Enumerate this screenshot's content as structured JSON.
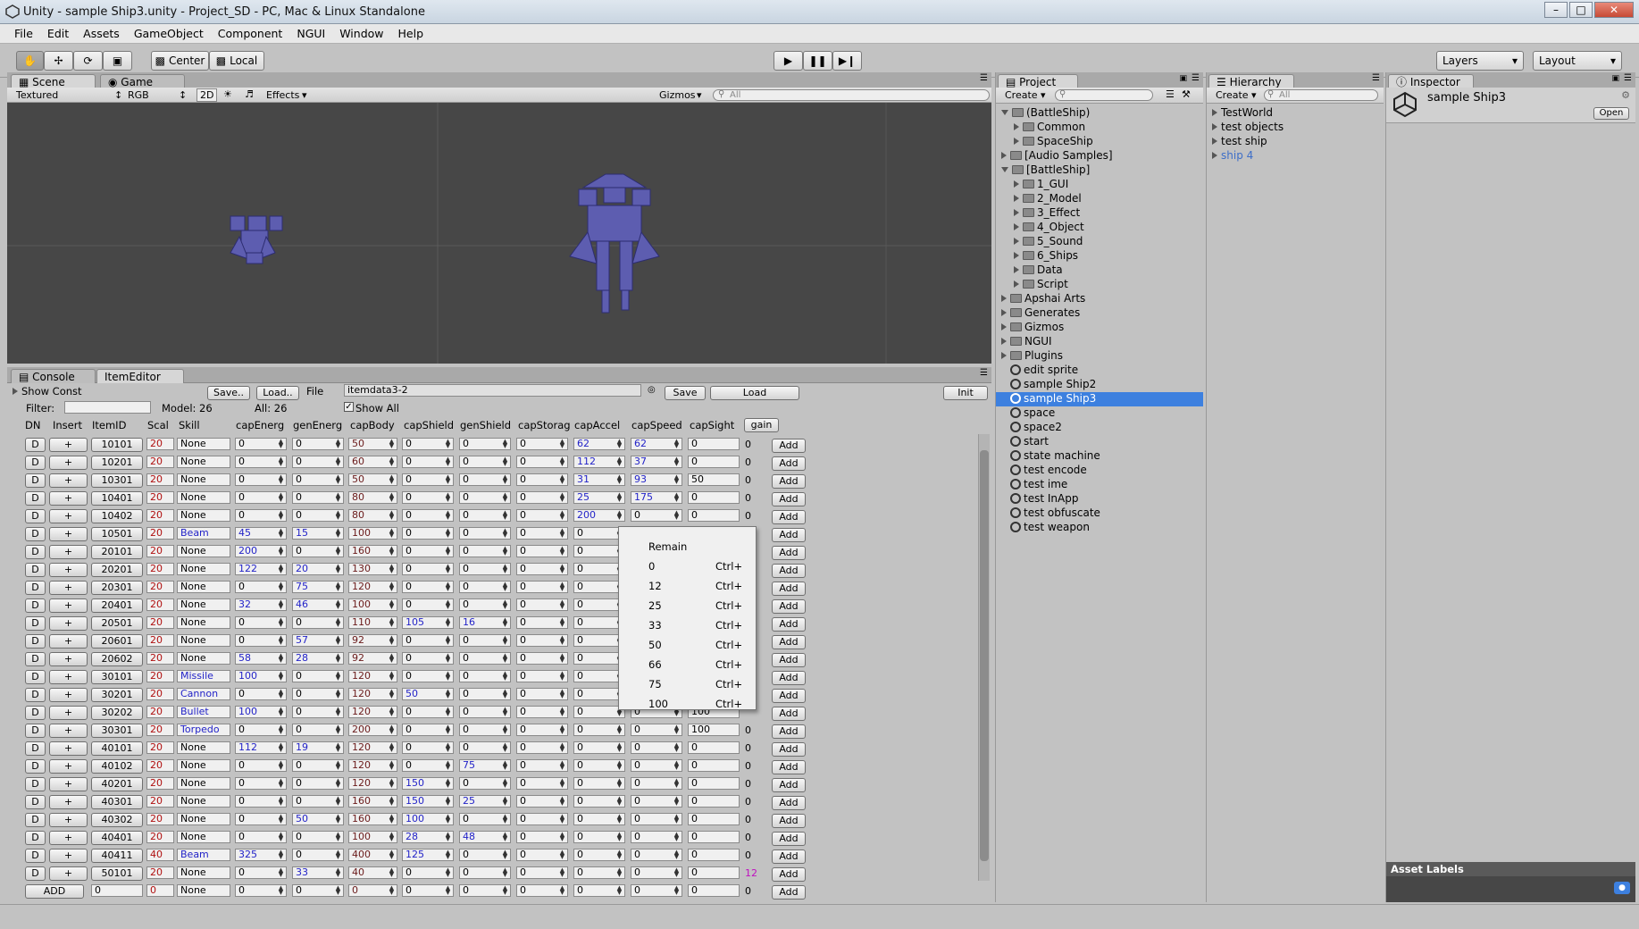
{
  "window": {
    "title": "Unity - sample Ship3.unity - Project_SD - PC, Mac & Linux Standalone"
  },
  "menu": [
    "File",
    "Edit",
    "Assets",
    "GameObject",
    "Component",
    "NGUI",
    "Window",
    "Help"
  ],
  "toolbar": {
    "pivot": "Center",
    "space": "Local",
    "layers": "Layers",
    "layout": "Layout"
  },
  "scene": {
    "tab_scene": "Scene",
    "tab_game": "Game",
    "shading": "Textured",
    "render": "RGB",
    "mode2d": "2D",
    "effects": "Effects",
    "gizmos": "Gizmos",
    "search_placeholder": "All"
  },
  "bottom_tabs": {
    "console": "Console",
    "item_editor": "ItemEditor"
  },
  "item_editor": {
    "show_const": "Show Const",
    "save_dots": "Save..",
    "load_dots": "Load..",
    "file_label": "File",
    "file_value": "itemdata3-2",
    "save": "Save",
    "load": "Load",
    "init": "Init",
    "filter_label": "Filter:",
    "model_count": "Model: 26",
    "all_count": "All: 26",
    "show_all": "Show All",
    "columns": [
      "DN",
      "Insert",
      "ItemID",
      "Scal",
      "Skill",
      "capEnerg",
      "genEnerg",
      "capBody",
      "capShield",
      "genShield",
      "capStorag",
      "capAccel",
      "capSpeed",
      "capSight"
    ],
    "gain": "gain",
    "d": "D",
    "plus": "+",
    "add": "Add",
    "add_big": "ADD",
    "rows": [
      {
        "id": "10101",
        "scale": "20",
        "skill": "None",
        "ce": "0",
        "ge": "0",
        "cb": "50",
        "cs": "0",
        "gs": "0",
        "cst": "0",
        "ca": "62",
        "csp": "62",
        "csi": "0",
        "last": "0"
      },
      {
        "id": "10201",
        "scale": "20",
        "skill": "None",
        "ce": "0",
        "ge": "0",
        "cb": "60",
        "cs": "0",
        "gs": "0",
        "cst": "0",
        "ca": "112",
        "csp": "37",
        "csi": "0",
        "last": "0"
      },
      {
        "id": "10301",
        "scale": "20",
        "skill": "None",
        "ce": "0",
        "ge": "0",
        "cb": "50",
        "cs": "0",
        "gs": "0",
        "cst": "0",
        "ca": "31",
        "csp": "93",
        "csi": "50",
        "last": "0"
      },
      {
        "id": "10401",
        "scale": "20",
        "skill": "None",
        "ce": "0",
        "ge": "0",
        "cb": "80",
        "cs": "0",
        "gs": "0",
        "cst": "0",
        "ca": "25",
        "csp": "175",
        "csi": "0",
        "last": "0"
      },
      {
        "id": "10402",
        "scale": "20",
        "skill": "None",
        "ce": "0",
        "ge": "0",
        "cb": "80",
        "cs": "0",
        "gs": "0",
        "cst": "0",
        "ca": "200",
        "csp": "0",
        "csi": "0",
        "last": "0"
      },
      {
        "id": "10501",
        "scale": "20",
        "skill": "Beam",
        "ce": "45",
        "ge": "15",
        "cb": "100",
        "cs": "0",
        "gs": "0",
        "cst": "0",
        "ca": "0",
        "csp": "",
        "csi": "",
        "last": ""
      },
      {
        "id": "20101",
        "scale": "20",
        "skill": "None",
        "ce": "200",
        "ge": "0",
        "cb": "160",
        "cs": "0",
        "gs": "0",
        "cst": "0",
        "ca": "0",
        "csp": "",
        "csi": "",
        "last": ""
      },
      {
        "id": "20201",
        "scale": "20",
        "skill": "None",
        "ce": "122",
        "ge": "20",
        "cb": "130",
        "cs": "0",
        "gs": "0",
        "cst": "0",
        "ca": "0",
        "csp": "",
        "csi": "",
        "last": ""
      },
      {
        "id": "20301",
        "scale": "20",
        "skill": "None",
        "ce": "0",
        "ge": "75",
        "cb": "120",
        "cs": "0",
        "gs": "0",
        "cst": "0",
        "ca": "0",
        "csp": "",
        "csi": "",
        "last": ""
      },
      {
        "id": "20401",
        "scale": "20",
        "skill": "None",
        "ce": "32",
        "ge": "46",
        "cb": "100",
        "cs": "0",
        "gs": "0",
        "cst": "0",
        "ca": "0",
        "csp": "",
        "csi": "",
        "last": ""
      },
      {
        "id": "20501",
        "scale": "20",
        "skill": "None",
        "ce": "0",
        "ge": "0",
        "cb": "110",
        "cs": "105",
        "gs": "16",
        "cst": "0",
        "ca": "0",
        "csp": "",
        "csi": "",
        "last": ""
      },
      {
        "id": "20601",
        "scale": "20",
        "skill": "None",
        "ce": "0",
        "ge": "57",
        "cb": "92",
        "cs": "0",
        "gs": "0",
        "cst": "0",
        "ca": "0",
        "csp": "",
        "csi": "",
        "last": ""
      },
      {
        "id": "20602",
        "scale": "20",
        "skill": "None",
        "ce": "58",
        "ge": "28",
        "cb": "92",
        "cs": "0",
        "gs": "0",
        "cst": "0",
        "ca": "0",
        "csp": "",
        "csi": "",
        "last": ""
      },
      {
        "id": "30101",
        "scale": "20",
        "skill": "Missile",
        "ce": "100",
        "ge": "0",
        "cb": "120",
        "cs": "0",
        "gs": "0",
        "cst": "0",
        "ca": "0",
        "csp": "",
        "csi": "",
        "last": ""
      },
      {
        "id": "30201",
        "scale": "20",
        "skill": "Cannon",
        "ce": "0",
        "ge": "0",
        "cb": "120",
        "cs": "50",
        "gs": "0",
        "cst": "0",
        "ca": "0",
        "csp": "",
        "csi": "",
        "last": ""
      },
      {
        "id": "30202",
        "scale": "20",
        "skill": "Bullet",
        "ce": "100",
        "ge": "0",
        "cb": "120",
        "cs": "0",
        "gs": "0",
        "cst": "0",
        "ca": "0",
        "csp": "0",
        "csi": "100",
        "last": ""
      },
      {
        "id": "30301",
        "scale": "20",
        "skill": "Torpedo",
        "ce": "0",
        "ge": "0",
        "cb": "200",
        "cs": "0",
        "gs": "0",
        "cst": "0",
        "ca": "0",
        "csp": "0",
        "csi": "100",
        "last": "0"
      },
      {
        "id": "40101",
        "scale": "20",
        "skill": "None",
        "ce": "112",
        "ge": "19",
        "cb": "120",
        "cs": "0",
        "gs": "0",
        "cst": "0",
        "ca": "0",
        "csp": "0",
        "csi": "0",
        "last": "0"
      },
      {
        "id": "40102",
        "scale": "20",
        "skill": "None",
        "ce": "0",
        "ge": "0",
        "cb": "120",
        "cs": "0",
        "gs": "75",
        "cst": "0",
        "ca": "0",
        "csp": "0",
        "csi": "0",
        "last": "0"
      },
      {
        "id": "40201",
        "scale": "20",
        "skill": "None",
        "ce": "0",
        "ge": "0",
        "cb": "120",
        "cs": "150",
        "gs": "0",
        "cst": "0",
        "ca": "0",
        "csp": "0",
        "csi": "0",
        "last": "0"
      },
      {
        "id": "40301",
        "scale": "20",
        "skill": "None",
        "ce": "0",
        "ge": "0",
        "cb": "160",
        "cs": "150",
        "gs": "25",
        "cst": "0",
        "ca": "0",
        "csp": "0",
        "csi": "0",
        "last": "0"
      },
      {
        "id": "40302",
        "scale": "20",
        "skill": "None",
        "ce": "0",
        "ge": "50",
        "cb": "160",
        "cs": "100",
        "gs": "0",
        "cst": "0",
        "ca": "0",
        "csp": "0",
        "csi": "0",
        "last": "0"
      },
      {
        "id": "40401",
        "scale": "20",
        "skill": "None",
        "ce": "0",
        "ge": "0",
        "cb": "100",
        "cs": "28",
        "gs": "48",
        "cst": "0",
        "ca": "0",
        "csp": "0",
        "csi": "0",
        "last": "0"
      },
      {
        "id": "40411",
        "scale": "40",
        "skill": "Beam",
        "ce": "325",
        "ge": "0",
        "cb": "400",
        "cs": "125",
        "gs": "0",
        "cst": "0",
        "ca": "0",
        "csp": "0",
        "csi": "0",
        "last": "0"
      },
      {
        "id": "50101",
        "scale": "20",
        "skill": "None",
        "ce": "0",
        "ge": "33",
        "cb": "40",
        "cs": "0",
        "gs": "0",
        "cst": "0",
        "ca": "0",
        "csp": "0",
        "csi": "0",
        "last": "12"
      }
    ],
    "new_row": {
      "id": "0",
      "scale": "0",
      "skill": "None",
      "ce": "0",
      "ge": "0",
      "cb": "0",
      "cs": "0",
      "gs": "0",
      "cst": "0",
      "ca": "0",
      "csp": "0",
      "csi": "0",
      "last": "0"
    }
  },
  "context_menu": {
    "items": [
      {
        "label": "Remain",
        "shortcut": ""
      },
      {
        "label": "0",
        "shortcut": "Ctrl+"
      },
      {
        "label": "12",
        "shortcut": "Ctrl+"
      },
      {
        "label": "25",
        "shortcut": "Ctrl+"
      },
      {
        "label": "33",
        "shortcut": "Ctrl+"
      },
      {
        "label": "50",
        "shortcut": "Ctrl+"
      },
      {
        "label": "66",
        "shortcut": "Ctrl+"
      },
      {
        "label": "75",
        "shortcut": "Ctrl+"
      },
      {
        "label": "100",
        "shortcut": "Ctrl+"
      }
    ]
  },
  "project": {
    "tab": "Project",
    "create": "Create",
    "items": [
      {
        "label": "(BattleShip)",
        "depth": 0,
        "type": "folder",
        "expanded": true
      },
      {
        "label": "Common",
        "depth": 1,
        "type": "folder",
        "expanded": false
      },
      {
        "label": "SpaceShip",
        "depth": 1,
        "type": "folder",
        "expanded": false
      },
      {
        "label": "[Audio Samples]",
        "depth": 0,
        "type": "folder",
        "expanded": false
      },
      {
        "label": "[BattleShip]",
        "depth": 0,
        "type": "folder",
        "expanded": true
      },
      {
        "label": "1_GUI",
        "depth": 1,
        "type": "folder",
        "expanded": false
      },
      {
        "label": "2_Model",
        "depth": 1,
        "type": "folder",
        "expanded": false
      },
      {
        "label": "3_Effect",
        "depth": 1,
        "type": "folder",
        "expanded": false
      },
      {
        "label": "4_Object",
        "depth": 1,
        "type": "folder",
        "expanded": false
      },
      {
        "label": "5_Sound",
        "depth": 1,
        "type": "folder",
        "expanded": false
      },
      {
        "label": "6_Ships",
        "depth": 1,
        "type": "folder",
        "expanded": false
      },
      {
        "label": "Data",
        "depth": 1,
        "type": "folder",
        "expanded": false
      },
      {
        "label": "Script",
        "depth": 1,
        "type": "folder",
        "expanded": false
      },
      {
        "label": "Apshai Arts",
        "depth": 0,
        "type": "folder",
        "expanded": false
      },
      {
        "label": "Generates",
        "depth": 0,
        "type": "folder",
        "expanded": false
      },
      {
        "label": "Gizmos",
        "depth": 0,
        "type": "folder",
        "expanded": false
      },
      {
        "label": "NGUI",
        "depth": 0,
        "type": "folder",
        "expanded": false
      },
      {
        "label": "Plugins",
        "depth": 0,
        "type": "folder",
        "expanded": false
      },
      {
        "label": "edit sprite",
        "depth": 0,
        "type": "scene"
      },
      {
        "label": "sample Ship2",
        "depth": 0,
        "type": "scene"
      },
      {
        "label": "sample Ship3",
        "depth": 0,
        "type": "scene",
        "selected": true
      },
      {
        "label": "space",
        "depth": 0,
        "type": "scene"
      },
      {
        "label": "space2",
        "depth": 0,
        "type": "scene"
      },
      {
        "label": "start",
        "depth": 0,
        "type": "scene"
      },
      {
        "label": "state machine",
        "depth": 0,
        "type": "scene"
      },
      {
        "label": "test encode",
        "depth": 0,
        "type": "scene"
      },
      {
        "label": "test ime",
        "depth": 0,
        "type": "scene"
      },
      {
        "label": "test InApp",
        "depth": 0,
        "type": "scene"
      },
      {
        "label": "test obfuscate",
        "depth": 0,
        "type": "scene"
      },
      {
        "label": "test weapon",
        "depth": 0,
        "type": "scene"
      }
    ]
  },
  "hierarchy": {
    "tab": "Hierarchy",
    "create": "Create",
    "search_placeholder": "All",
    "items": [
      "TestWorld",
      "test objects",
      "test ship",
      "ship 4"
    ]
  },
  "inspector": {
    "tab": "Inspector",
    "title": "sample Ship3",
    "open": "Open",
    "asset_labels": "Asset Labels"
  },
  "colors": {
    "selection": "#3d80df",
    "blue_value": "#2323c8",
    "scale_red": "#b01010",
    "magenta": "#c010c0",
    "ship": "#5d5db0"
  }
}
